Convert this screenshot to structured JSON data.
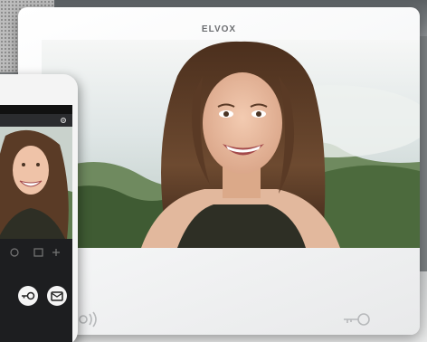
{
  "monitor": {
    "brand": "ELVOX"
  },
  "icons": {
    "monitor_mic": "microphone-speaker-icon",
    "monitor_key": "door-key-icon",
    "phone_gear": "gear-icon",
    "phone_key": "key-icon",
    "phone_mail": "message-icon"
  },
  "colors": {
    "monitor_body": "#f3f4f5",
    "phone_ui": "#1d1e20"
  }
}
